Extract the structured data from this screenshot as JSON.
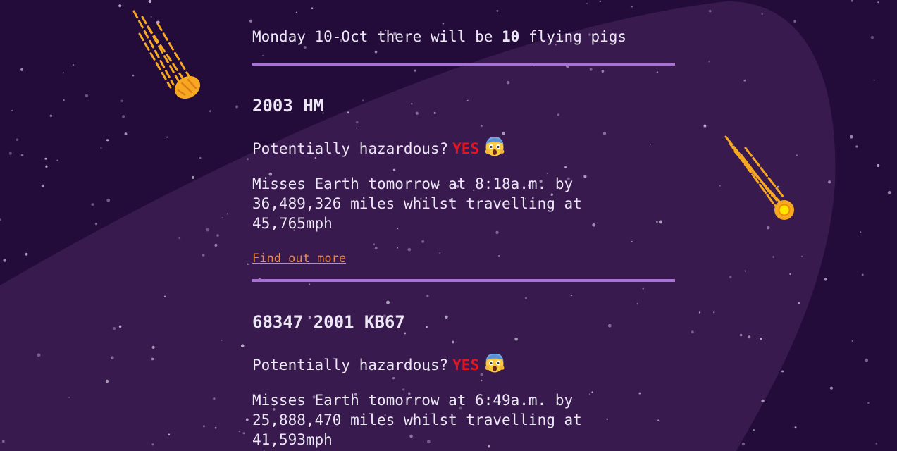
{
  "intro": {
    "day": "Monday 10-Oct",
    "prefix_text": " there will be ",
    "count": "10",
    "suffix_text": " flying pigs"
  },
  "asteroids": [
    {
      "name": "2003 HM",
      "hazard_label": "Potentially hazardous?",
      "hazard_value": "YES",
      "description": "Misses Earth tomorrow at 8:18a.m. by 36,489,326 miles whilst travelling at 45,765mph",
      "link_text": "Find out more"
    },
    {
      "name": "68347 2001 KB67",
      "hazard_label": "Potentially hazardous?",
      "hazard_value": "YES",
      "description": "Misses Earth tomorrow at 6:49a.m. by 25,888,470 miles whilst travelling at 41,593mph"
    }
  ],
  "icons": {
    "hazard_emoji": "screaming-face-icon",
    "meteor_left": "meteor-icon",
    "meteor_right": "meteor-icon"
  },
  "colors": {
    "background": "#230b3a",
    "spotlight": "#381a4f",
    "divider": "#a673d3",
    "hazard_yes": "#e8141c",
    "link": "#f0883e",
    "meteor": "#f7a822"
  }
}
